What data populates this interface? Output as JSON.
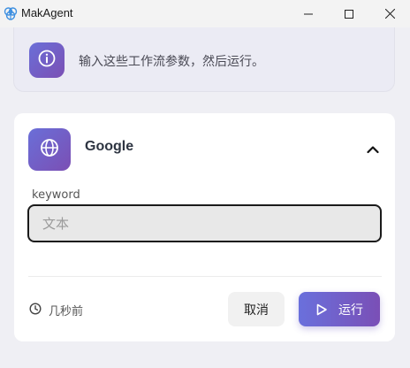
{
  "window": {
    "title": "MakAgent",
    "icons": {
      "logo": "brain-logo-icon",
      "minimize": "minimize-icon",
      "maximize": "maximize-icon",
      "close": "close-icon"
    }
  },
  "info": {
    "icon": "info-icon",
    "message": "输入这些工作流参数，然后运行。"
  },
  "tool": {
    "icon": "globe-icon",
    "name": "Google",
    "collapse_icon": "chevron-up-icon",
    "field": {
      "label": "keyword",
      "value": "",
      "placeholder": "文本"
    }
  },
  "footer": {
    "time_icon": "clock-icon",
    "time_text": "几秒前",
    "cancel_label": "取消",
    "run_label": "运行",
    "run_icon": "play-icon"
  },
  "colors": {
    "accent_start": "#6a70dc",
    "accent_end": "#7a4fb6",
    "background": "#efeff4",
    "card": "#ffffff"
  }
}
